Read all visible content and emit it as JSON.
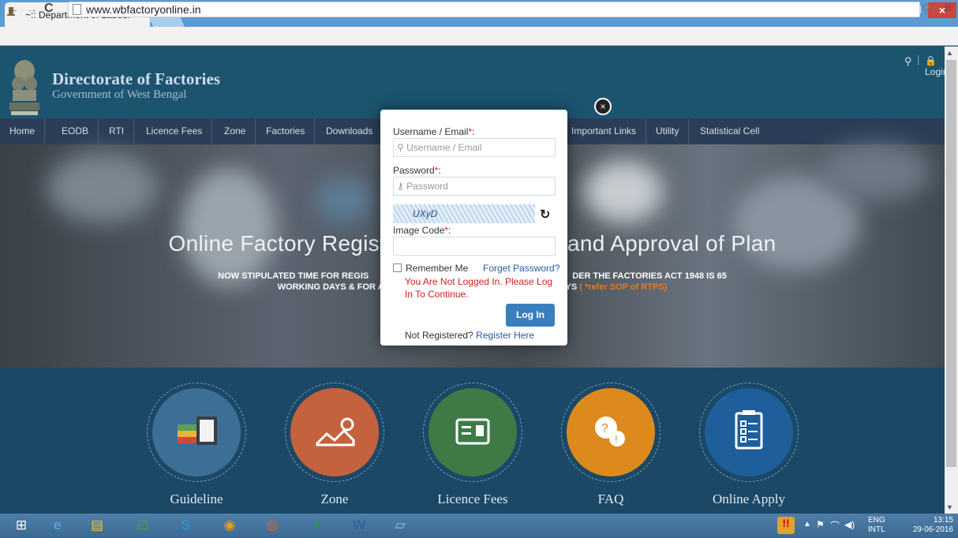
{
  "browser": {
    "tab_title": "~:: Department of Labour",
    "tab_close": "×",
    "url": "www.wbfactoryonline.in",
    "back": "←",
    "forward": "→",
    "reload": "C",
    "zoom_star": "⚲☆",
    "menu": "≡",
    "window_controls": {
      "user": "▲",
      "minimize": "–",
      "maximize": "❐",
      "close": "×"
    }
  },
  "header": {
    "title": "Directorate of Factories",
    "subtitle": "Government of West Bengal",
    "search_icon": "search-icon",
    "search_glyph": "⚲",
    "separator": "|",
    "login": "🔒Login"
  },
  "nav": {
    "items": [
      "Home",
      "EODB",
      "RTI",
      "Licence Fees",
      "Zone",
      "Factories",
      "Downloads",
      "Important Links",
      "Utility",
      "Statistical Cell"
    ]
  },
  "hero": {
    "title": "Online Factory Regist                                  and Approval of Plan",
    "title_left": "Online Factory Regist",
    "title_right": "and Approval of Plan",
    "sub_line1_left": "NOW STIPULATED TIME FOR REGIS",
    "sub_line1_right": "DER THE FACTORIES ACT 1948 IS 65",
    "sub_line2_left": "WORKING DAYS & FOR A",
    "sub_line2_right": "YS",
    "sop_note": "( *refer SOP of RTPS)"
  },
  "services": [
    {
      "label": "Guideline",
      "icon": "books-icon",
      "color": "#3d6f96"
    },
    {
      "label": "Zone",
      "icon": "map-icon",
      "color": "#c5623e"
    },
    {
      "label": "Licence Fees",
      "icon": "id-card-icon",
      "color": "#3f7a46"
    },
    {
      "label": "FAQ",
      "icon": "question-chat-icon",
      "color": "#dd8a1c"
    },
    {
      "label": "Online Apply",
      "icon": "checklist-icon",
      "color": "#1e5e9a"
    }
  ],
  "modal": {
    "close": "×",
    "username_label": "Username / Email",
    "username_placeholder": "Username / Email",
    "password_label": "Password",
    "password_placeholder": "Password",
    "captcha_text": "UXyD",
    "refresh": "↻",
    "image_code_label": "Image Code",
    "required_mark": "*",
    "colon": ":",
    "remember_me": "Remember Me",
    "forget_password": "Forget Password?",
    "error": "You Are Not Logged In. Please Log In To Continue.",
    "login_button": "Log In",
    "not_registered": "Not Registered?",
    "register_here": "Register Here"
  },
  "taskbar": {
    "apps": [
      {
        "name": "windows-start-icon",
        "glyph": "⊞",
        "color": "#ffffff"
      },
      {
        "name": "internet-explorer-icon",
        "glyph": "e",
        "color": "#5cb0f0"
      },
      {
        "name": "file-explorer-icon",
        "glyph": "▤",
        "color": "#f0c64a"
      },
      {
        "name": "store-icon",
        "glyph": "⊡",
        "color": "#3ca54a"
      },
      {
        "name": "skype-icon",
        "glyph": "S",
        "color": "#1ea0e0"
      },
      {
        "name": "chrome-icon",
        "glyph": "◉",
        "color": "#e0a020"
      },
      {
        "name": "firefox-icon",
        "glyph": "◍",
        "color": "#e06020"
      },
      {
        "name": "excel-icon",
        "glyph": "X",
        "color": "#2b9a4a"
      },
      {
        "name": "word-icon",
        "glyph": "W",
        "color": "#2b5aa6"
      },
      {
        "name": "notebook-icon",
        "glyph": "▱",
        "color": "#a0c8e8"
      }
    ],
    "tray_flag": "!!",
    "tray_up": "▲",
    "tray_net": "⚑",
    "tray_signal": "⌒",
    "tray_volume": "◀)",
    "lang_line1": "ENG",
    "lang_line2": "INTL",
    "time": "13:15",
    "date": "29-06-2016"
  },
  "scroll": {
    "up": "▲",
    "down": "▼"
  }
}
